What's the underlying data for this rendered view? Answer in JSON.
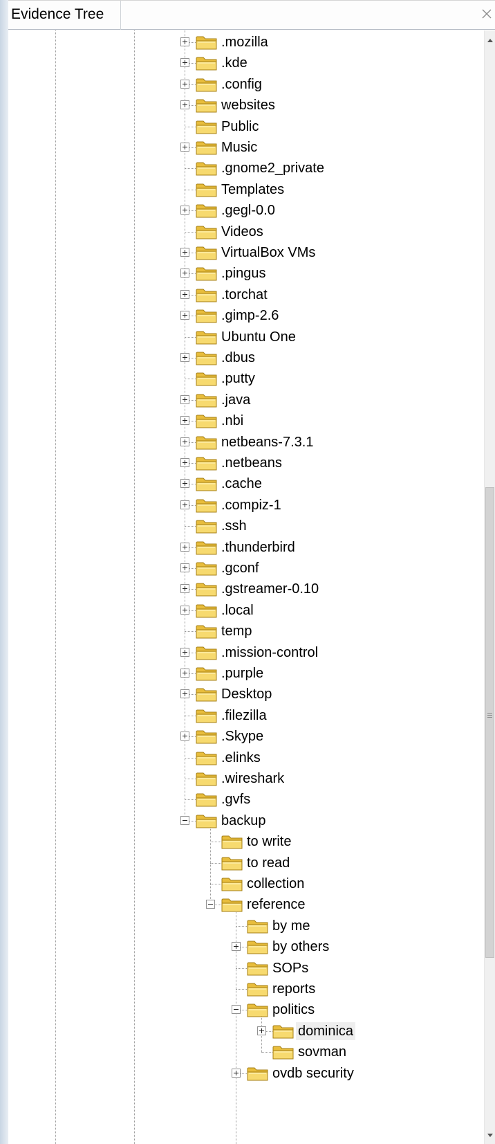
{
  "window": {
    "title": "Evidence Tree"
  },
  "icons": {
    "folder": "folder-icon",
    "close": "close-icon"
  },
  "colors": {
    "folder_fill": "#f5d56a",
    "folder_edge": "#b8911c",
    "selected_bg": "#eeeeee"
  },
  "tree": {
    "rows": [
      {
        "label": ".mozilla",
        "depth": 0,
        "expander": "plus"
      },
      {
        "label": ".kde",
        "depth": 0,
        "expander": "plus"
      },
      {
        "label": ".config",
        "depth": 0,
        "expander": "plus"
      },
      {
        "label": "websites",
        "depth": 0,
        "expander": "plus"
      },
      {
        "label": "Public",
        "depth": 0,
        "expander": "none"
      },
      {
        "label": "Music",
        "depth": 0,
        "expander": "plus"
      },
      {
        "label": ".gnome2_private",
        "depth": 0,
        "expander": "none"
      },
      {
        "label": "Templates",
        "depth": 0,
        "expander": "none"
      },
      {
        "label": ".gegl-0.0",
        "depth": 0,
        "expander": "plus"
      },
      {
        "label": "Videos",
        "depth": 0,
        "expander": "none"
      },
      {
        "label": "VirtualBox VMs",
        "depth": 0,
        "expander": "plus"
      },
      {
        "label": ".pingus",
        "depth": 0,
        "expander": "plus"
      },
      {
        "label": ".torchat",
        "depth": 0,
        "expander": "plus"
      },
      {
        "label": ".gimp-2.6",
        "depth": 0,
        "expander": "plus"
      },
      {
        "label": "Ubuntu One",
        "depth": 0,
        "expander": "none"
      },
      {
        "label": ".dbus",
        "depth": 0,
        "expander": "plus"
      },
      {
        "label": ".putty",
        "depth": 0,
        "expander": "none"
      },
      {
        "label": ".java",
        "depth": 0,
        "expander": "plus"
      },
      {
        "label": ".nbi",
        "depth": 0,
        "expander": "plus"
      },
      {
        "label": "netbeans-7.3.1",
        "depth": 0,
        "expander": "plus"
      },
      {
        "label": ".netbeans",
        "depth": 0,
        "expander": "plus"
      },
      {
        "label": ".cache",
        "depth": 0,
        "expander": "plus"
      },
      {
        "label": ".compiz-1",
        "depth": 0,
        "expander": "plus"
      },
      {
        "label": ".ssh",
        "depth": 0,
        "expander": "none"
      },
      {
        "label": ".thunderbird",
        "depth": 0,
        "expander": "plus"
      },
      {
        "label": ".gconf",
        "depth": 0,
        "expander": "plus"
      },
      {
        "label": ".gstreamer-0.10",
        "depth": 0,
        "expander": "plus"
      },
      {
        "label": ".local",
        "depth": 0,
        "expander": "plus"
      },
      {
        "label": "temp",
        "depth": 0,
        "expander": "none"
      },
      {
        "label": ".mission-control",
        "depth": 0,
        "expander": "plus"
      },
      {
        "label": ".purple",
        "depth": 0,
        "expander": "plus"
      },
      {
        "label": "Desktop",
        "depth": 0,
        "expander": "plus"
      },
      {
        "label": ".filezilla",
        "depth": 0,
        "expander": "none"
      },
      {
        "label": ".Skype",
        "depth": 0,
        "expander": "plus"
      },
      {
        "label": ".elinks",
        "depth": 0,
        "expander": "none"
      },
      {
        "label": ".wireshark",
        "depth": 0,
        "expander": "none"
      },
      {
        "label": ".gvfs",
        "depth": 0,
        "expander": "none"
      },
      {
        "label": "backup",
        "depth": 0,
        "expander": "minus"
      },
      {
        "label": "to write",
        "depth": 1,
        "expander": "none"
      },
      {
        "label": "to read",
        "depth": 1,
        "expander": "none"
      },
      {
        "label": "collection",
        "depth": 1,
        "expander": "none"
      },
      {
        "label": "reference",
        "depth": 1,
        "expander": "minus"
      },
      {
        "label": "by me",
        "depth": 2,
        "expander": "none"
      },
      {
        "label": "by others",
        "depth": 2,
        "expander": "plus"
      },
      {
        "label": "SOPs",
        "depth": 2,
        "expander": "none"
      },
      {
        "label": "reports",
        "depth": 2,
        "expander": "none"
      },
      {
        "label": "politics",
        "depth": 2,
        "expander": "minus"
      },
      {
        "label": "dominica",
        "depth": 3,
        "expander": "plus",
        "selected": true
      },
      {
        "label": "sovman",
        "depth": 3,
        "expander": "none"
      },
      {
        "label": "ovdb security",
        "depth": 2,
        "expander": "plus"
      }
    ]
  }
}
